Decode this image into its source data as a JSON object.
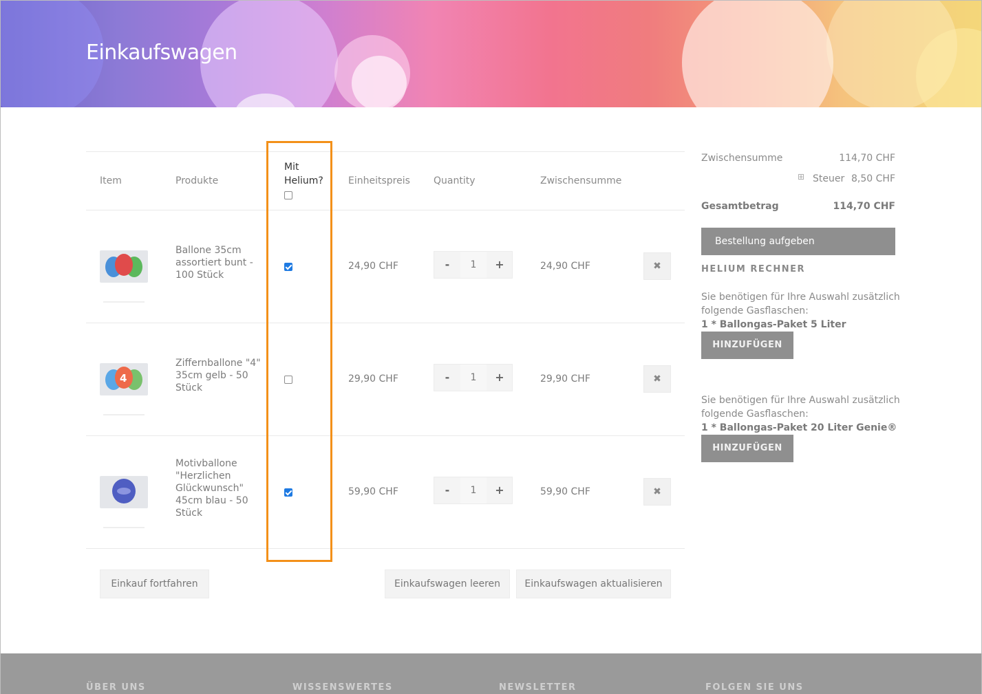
{
  "page": {
    "title": "Einkaufswagen"
  },
  "table": {
    "headers": {
      "item": "Item",
      "products": "Produkte",
      "helium_line1": "Mit",
      "helium_line2": "Helium?",
      "unit_price": "Einheitspreis",
      "quantity": "Quantity",
      "subtotal": "Zwischensumme"
    },
    "helium_all_checked": false,
    "rows": [
      {
        "name_lines": [
          "Ballone 35cm",
          "assortiert bunt -",
          "100 Stück"
        ],
        "helium": true,
        "unit_price": "24,90 CHF",
        "qty": "1",
        "subtotal": "24,90 CHF"
      },
      {
        "name_lines": [
          "Ziffernballone \"4\"",
          "35cm gelb - 50",
          "Stück"
        ],
        "helium": false,
        "unit_price": "29,90 CHF",
        "qty": "1",
        "subtotal": "29,90 CHF"
      },
      {
        "name_lines": [
          "Motivballone",
          "\"Herzlichen",
          "Glückwunsch\"",
          "45cm blau - 50",
          "Stück"
        ],
        "helium": true,
        "unit_price": "59,90 CHF",
        "qty": "1",
        "subtotal": "59,90 CHF"
      }
    ],
    "minus": "-",
    "plus": "+",
    "remove": "✖"
  },
  "buttons": {
    "continue": "Einkauf fortfahren",
    "clear": "Einkaufswagen leeren",
    "update": "Einkaufswagen aktualisieren"
  },
  "summary": {
    "subtotal_label": "Zwischensumme",
    "subtotal_value": "114,70 CHF",
    "tax_toggle": "⊞",
    "tax_label": "Steuer",
    "tax_value": "8,50 CHF",
    "total_label": "Gesamtbetrag",
    "total_value": "114,70 CHF",
    "checkout": "Bestellung aufgeben"
  },
  "helium": {
    "heading": "HELIUM RECHNER",
    "blocks": [
      {
        "line1": "Sie benötigen für Ihre Auswahl zusätzlich",
        "line2": "folgende Gasflaschen:",
        "product": "1 * Ballongas-Paket 5 Liter",
        "button": "HINZUFÜGEN"
      },
      {
        "line1": "Sie benötigen für Ihre Auswahl zusätzlich",
        "line2": "folgende Gasflaschen:",
        "product": "1 * Ballongas-Paket 20 Liter Genie®",
        "button": "HINZUFÜGEN"
      }
    ]
  },
  "footer": {
    "cols": [
      "ÜBER UNS",
      "WISSENSWERTES",
      "NEWSLETTER",
      "FOLGEN SIE UNS"
    ]
  },
  "colors": {
    "highlight": "#f39019",
    "checkbox": "#1e7ae2",
    "button_dark": "#8f8f8f",
    "footer": "#9a9a9a"
  }
}
